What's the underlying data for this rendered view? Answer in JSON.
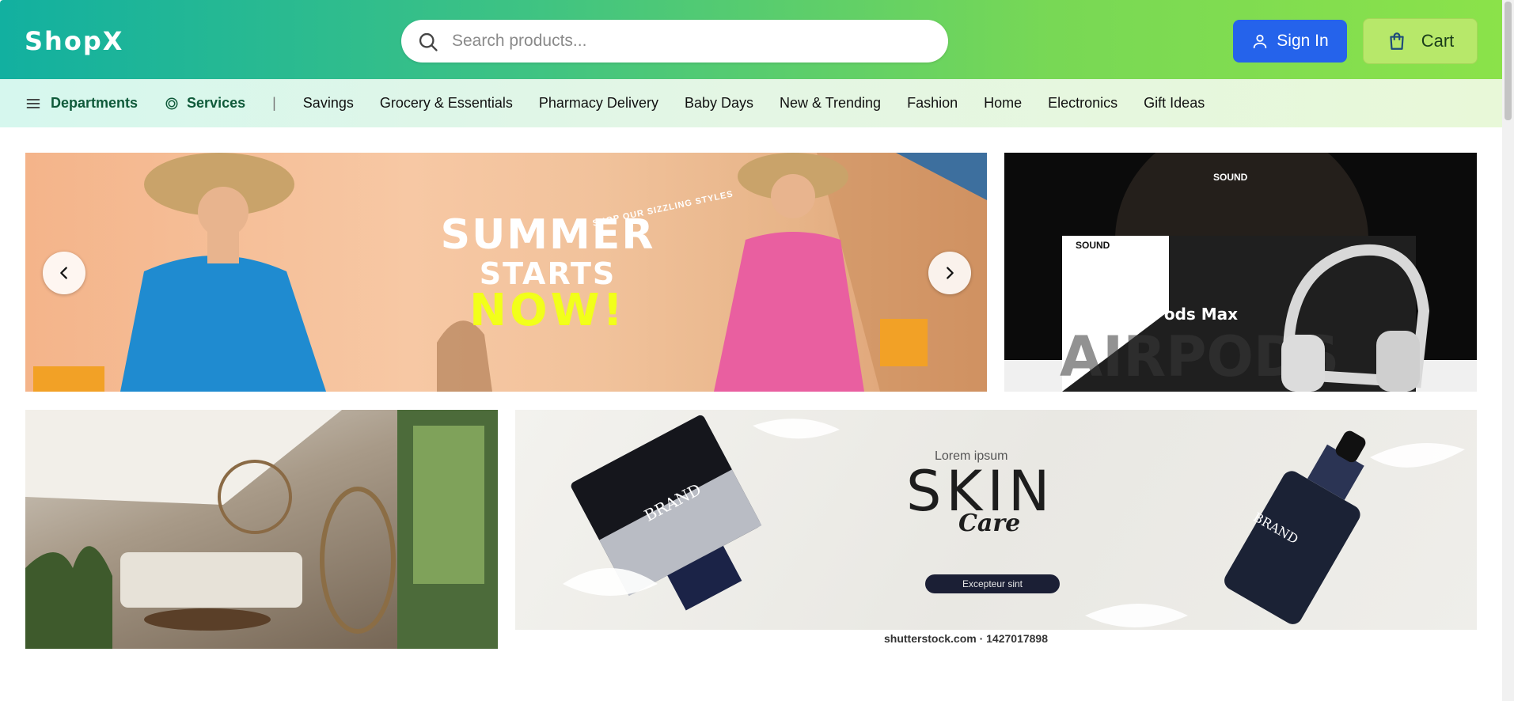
{
  "header": {
    "logo": "ShopX",
    "search": {
      "placeholder": "Search products...",
      "icon": "search-icon"
    },
    "signin_label": "Sign In",
    "cart_label": "Cart",
    "colors": {
      "gradient_start": "#12b0a0",
      "gradient_end": "#8be24a",
      "signin_bg": "#2563eb",
      "cart_bg": "#b7e86a"
    }
  },
  "nav": {
    "departments_label": "Departments",
    "services_label": "Services",
    "separator": "|",
    "items": [
      {
        "label": "Savings"
      },
      {
        "label": "Grocery & Essentials"
      },
      {
        "label": "Pharmacy Delivery"
      },
      {
        "label": "Baby Days"
      },
      {
        "label": "New & Trending"
      },
      {
        "label": "Fashion"
      },
      {
        "label": "Home"
      },
      {
        "label": "Electronics"
      },
      {
        "label": "Gift Ideas"
      }
    ]
  },
  "banners": {
    "summer": {
      "line1": "SUMMER",
      "line2": "STARTS",
      "line3": "NOW!",
      "curved": "SHOP OUR SIZZLING STYLES"
    },
    "airpods": {
      "sound_top": "SOUND",
      "sound_inner": "SOUND",
      "product": "AirPods Max",
      "watermark": "AIRPODS"
    },
    "skin": {
      "lorem": "Lorem ipsum",
      "title": "SKIN",
      "subtitle": "Care",
      "button": "Excepteur sint",
      "brand": "BRAND",
      "credit": "shutterstock.com · 1427017898"
    }
  }
}
